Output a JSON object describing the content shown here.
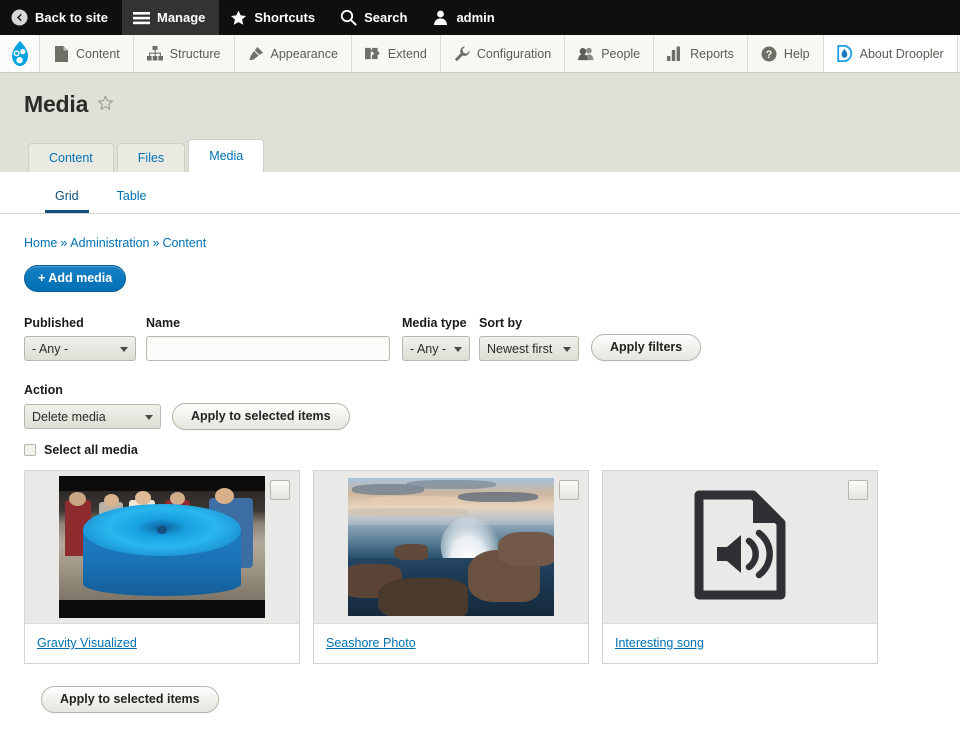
{
  "admin_toolbar": {
    "items": [
      {
        "label": "Back to site",
        "icon": "back-arrow-icon",
        "active": false
      },
      {
        "label": "Manage",
        "icon": "hamburger-icon",
        "active": true
      },
      {
        "label": "Shortcuts",
        "icon": "star-icon",
        "active": false
      },
      {
        "label": "Search",
        "icon": "search-icon",
        "active": false
      },
      {
        "label": "admin",
        "icon": "user-icon",
        "active": false
      }
    ]
  },
  "admin_menu": {
    "logo": "drupal-drop-logo",
    "items": [
      {
        "label": "Content",
        "icon": "file-icon"
      },
      {
        "label": "Structure",
        "icon": "sitemap-icon"
      },
      {
        "label": "Appearance",
        "icon": "paintbrush-icon"
      },
      {
        "label": "Extend",
        "icon": "puzzle-piece-icon"
      },
      {
        "label": "Configuration",
        "icon": "wrench-icon"
      },
      {
        "label": "People",
        "icon": "people-icon"
      },
      {
        "label": "Reports",
        "icon": "bar-chart-icon"
      },
      {
        "label": "Help",
        "icon": "question-mark-icon"
      },
      {
        "label": "About Droopler",
        "icon": "droopler-logo-icon"
      }
    ]
  },
  "page": {
    "title": "Media",
    "favorite_icon": "star-outline-icon"
  },
  "primary_tabs": [
    {
      "label": "Content",
      "active": false
    },
    {
      "label": "Files",
      "active": false
    },
    {
      "label": "Media",
      "active": true
    }
  ],
  "secondary_tabs": [
    {
      "label": "Grid",
      "active": true
    },
    {
      "label": "Table",
      "active": false
    }
  ],
  "breadcrumb": {
    "items": [
      "Home",
      "Administration",
      "Content"
    ],
    "separator": "»"
  },
  "actions": {
    "add_media_label": "+ Add media"
  },
  "filters": {
    "published": {
      "label": "Published",
      "value": "- Any -"
    },
    "name": {
      "label": "Name",
      "value": "",
      "placeholder": ""
    },
    "media_type": {
      "label": "Media type",
      "value": "- Any -"
    },
    "sort_by": {
      "label": "Sort by",
      "value": "Newest first"
    },
    "apply_label": "Apply filters"
  },
  "bulk": {
    "action_label": "Action",
    "action_value": "Delete media",
    "apply_label": "Apply to selected items",
    "select_all_label": "Select all media"
  },
  "media_items": [
    {
      "title": "Gravity Visualized",
      "thumb": "video-thumbnail-gravity-well",
      "checked": false
    },
    {
      "title": "Seashore Photo",
      "thumb": "photo-thumbnail-seashore",
      "checked": false
    },
    {
      "title": "Interesting song",
      "thumb": "audio-file-icon",
      "checked": false
    }
  ],
  "footer": {
    "apply_label": "Apply to selected items"
  },
  "colors": {
    "toolbar_bg": "#0f0f0f",
    "toolbar_active_bg": "#333333",
    "menu_bg": "#f7f7f4",
    "page_head_bg": "#e0e0d8",
    "link_blue": "#0071b3",
    "primary_button_blue": "#0071b8",
    "active_tab_underline": "#124f7c"
  }
}
